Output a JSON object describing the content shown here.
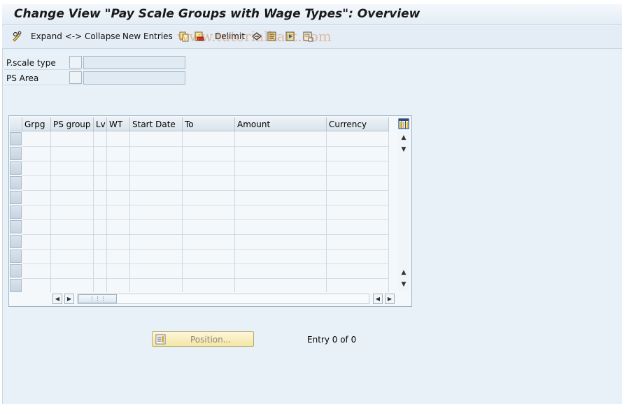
{
  "title": "Change View \"Pay Scale Groups with Wage Types\": Overview",
  "toolbar": {
    "expand_collapse": "Expand <-> Collapse",
    "new_entries": "New Entries",
    "delimit": "Delimit",
    "icons": [
      "glasses-pen-icon",
      "copy-icon",
      "save-red-icon",
      "undo-icon",
      "select-all-icon",
      "select-block-icon",
      "deselect-icon"
    ]
  },
  "watermark": "www.tutorialkart.com",
  "fields": {
    "pscale_type_label": "P.scale type",
    "ps_area_label": "PS Area",
    "pscale_type_value": "",
    "ps_area_value": ""
  },
  "table": {
    "columns": [
      "Grpg",
      "PS group",
      "Lv",
      "WT",
      "Start Date",
      "To",
      "Amount",
      "Currency"
    ],
    "rows": [],
    "visible_row_count": 11
  },
  "position_button": "Position...",
  "entry_text": "Entry 0 of 0",
  "colors": {
    "background": "#e8f1f8",
    "button_yellow": "#f3e6a6"
  }
}
